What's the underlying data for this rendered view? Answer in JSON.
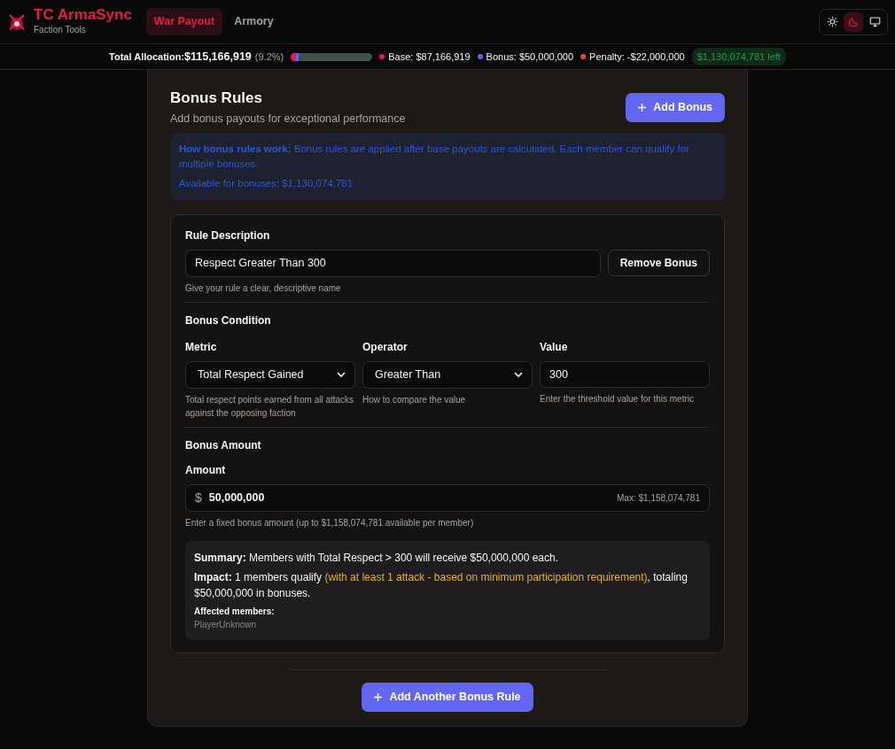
{
  "brand": {
    "title": "TC ArmaSync",
    "subtitle": "Faction Tools"
  },
  "tabs": [
    {
      "label": "War Payout",
      "selected": true
    },
    {
      "label": "Armory",
      "selected": false
    }
  ],
  "theme_toggle": [
    {
      "kind": "light",
      "selected": false
    },
    {
      "kind": "dark",
      "selected": true
    },
    {
      "kind": "system",
      "selected": false
    }
  ],
  "allocation": {
    "label": "Total Allocation:",
    "total": "$115,166,919",
    "percent": "(9.2%)",
    "segments": [
      {
        "color": "#e11d48",
        "level": 0.064
      },
      {
        "color": "#6366f1",
        "level": 0.036
      }
    ],
    "legend": [
      {
        "color": "#e11d48",
        "text": "Base: $87,166,919"
      },
      {
        "color": "#6366f1",
        "text": "Bonus: $50,000,000"
      },
      {
        "color": "#ef4444",
        "text": "Penalty: -$22,000,000"
      }
    ],
    "remaining": "$1,130,074,781 left"
  },
  "section": {
    "title": "Bonus Rules",
    "subtitle": "Add bonus payouts for exceptional performance",
    "add_button": "Add Bonus",
    "info": {
      "text": "**How bonus rules work:** Bonus rules are applied after base payouts are calculated. Each member can qualify for multiple bonuses.",
      "available": "Available for bonuses: $1,130,074,781"
    }
  },
  "rules": [
    {
      "description_label": "Rule Description",
      "description_value": "Respect Greater Than 300",
      "description_help": "Give your rule a clear, descriptive name",
      "remove_button": "Remove Bonus",
      "condition_title": "Bonus Condition",
      "condition_fields": [
        {
          "kind": "select",
          "label": "Metric",
          "value": "Total Respect Gained",
          "help": "Total respect points earned from all attacks against the opposing faction"
        },
        {
          "kind": "select",
          "label": "Operator",
          "value": "Greater Than",
          "help": "How to compare the value"
        },
        {
          "kind": "input",
          "label": "Value",
          "value": "300",
          "help": "Enter the threshold value for this metric"
        }
      ],
      "amount_title": "Bonus Amount",
      "amount_label": "Amount",
      "currency": "$",
      "amount_value": "50,000,000",
      "amount_max": "Max: $1,158,074,781",
      "amount_help": "Enter a fixed bonus amount (up to $1,158,074,781 available per member)",
      "summary": "**Summary:** Members with Total Respect > 300 will receive $50,000,000 each.",
      "impact": {
        "lead": "**Impact:** 1 members qualify",
        "note": "(with at least 1 attack - based on minimum participation requirement)",
        "tail": ", totaling $50,000,000 in bonuses."
      },
      "affected_label": "Affected members:",
      "affected": [
        "PlayerUnknown"
      ]
    }
  ],
  "add_another": "Add Another Bonus Rule"
}
